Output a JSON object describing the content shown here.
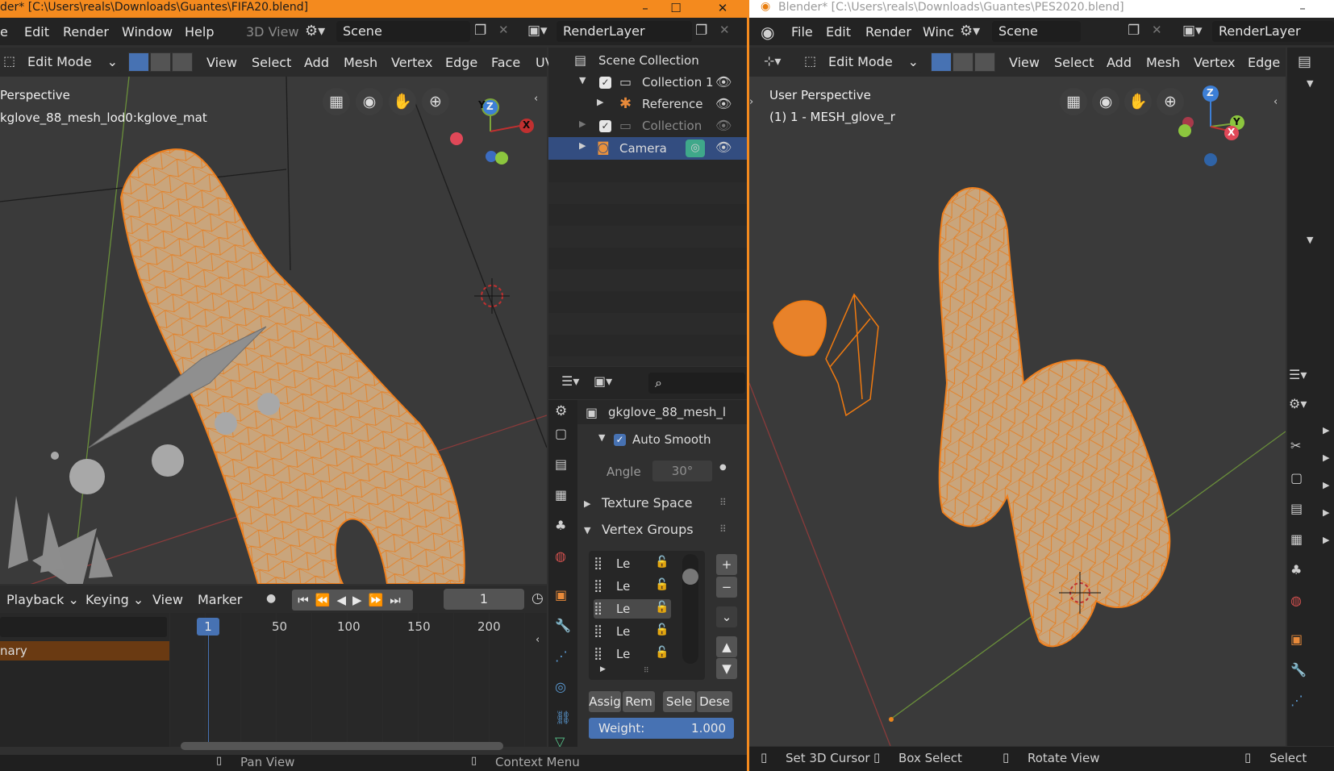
{
  "left": {
    "title": "der* [C:\\Users\\reals\\Downloads\\Guantes\\FIFA20.blend]",
    "title_controls": [
      "–",
      "☐",
      "✕"
    ],
    "menu": [
      "e",
      "Edit",
      "Render",
      "Window",
      "Help"
    ],
    "editor_tab": "3D View",
    "scene": "Scene",
    "render_layer": "RenderLayer",
    "viewport": {
      "mode": "Edit Mode",
      "menu": [
        "View",
        "Select",
        "Add",
        "Mesh",
        "Vertex",
        "Edge",
        "Face",
        "UV"
      ],
      "overlay_title": "Perspective",
      "overlay_object": "kglove_88_mesh_lod0:kglove_mat",
      "gizmo": {
        "z": "Z",
        "y": "Y",
        "x": "X"
      }
    },
    "outliner": {
      "title": "Scene Collection",
      "items": [
        {
          "label": "Collection 1",
          "selected": false
        },
        {
          "label": "Reference",
          "selected": false
        },
        {
          "label": "Collection 1",
          "selected": false
        },
        {
          "label": "Camera",
          "selected": true
        }
      ]
    },
    "properties": {
      "object_name": "gkglove_88_mesh_l",
      "auto_smooth": "Auto Smooth",
      "angle_label": "Angle",
      "angle_value": "30°",
      "texture_space": "Texture Space",
      "vertex_groups": "Vertex Groups",
      "groups": [
        "Le",
        "Le",
        "Le",
        "Le",
        "Le"
      ],
      "active_group_index": 2,
      "buttons": [
        "Assig",
        "Rem",
        "Sele",
        "Dese"
      ],
      "weight_label": "Weight:",
      "weight_value": "1.000"
    },
    "timeline": {
      "menu": [
        "Playback",
        "Keying",
        "View",
        "Marker"
      ],
      "current_frame": "1",
      "ticks": [
        "50",
        "100",
        "150",
        "200"
      ],
      "marker": "1",
      "channel": "nary"
    },
    "status": [
      "Pan View",
      "Context Menu"
    ]
  },
  "right": {
    "title": "Blender* [C:\\Users\\reals\\Downloads\\Guantes\\PES2020.blend]",
    "title_controls": [
      "–"
    ],
    "menu": [
      "File",
      "Edit",
      "Render",
      "Winc"
    ],
    "scene": "Scene",
    "render_layer": "RenderLayer",
    "viewport": {
      "mode": "Edit Mode",
      "menu": [
        "View",
        "Select",
        "Add",
        "Mesh",
        "Vertex",
        "Edge"
      ],
      "overlay_title": "User Perspective",
      "overlay_object": "(1) 1 - MESH_glove_r",
      "gizmo": {
        "z": "Z",
        "y": "Y",
        "x": "X"
      }
    },
    "status": [
      "Set 3D Cursor",
      "Box Select",
      "Rotate View",
      "Select"
    ]
  },
  "colors": {
    "accent": "#4772b3",
    "mesh": "#f0801e",
    "title_active": "#f48a1e",
    "skin": "#c9a57c"
  }
}
